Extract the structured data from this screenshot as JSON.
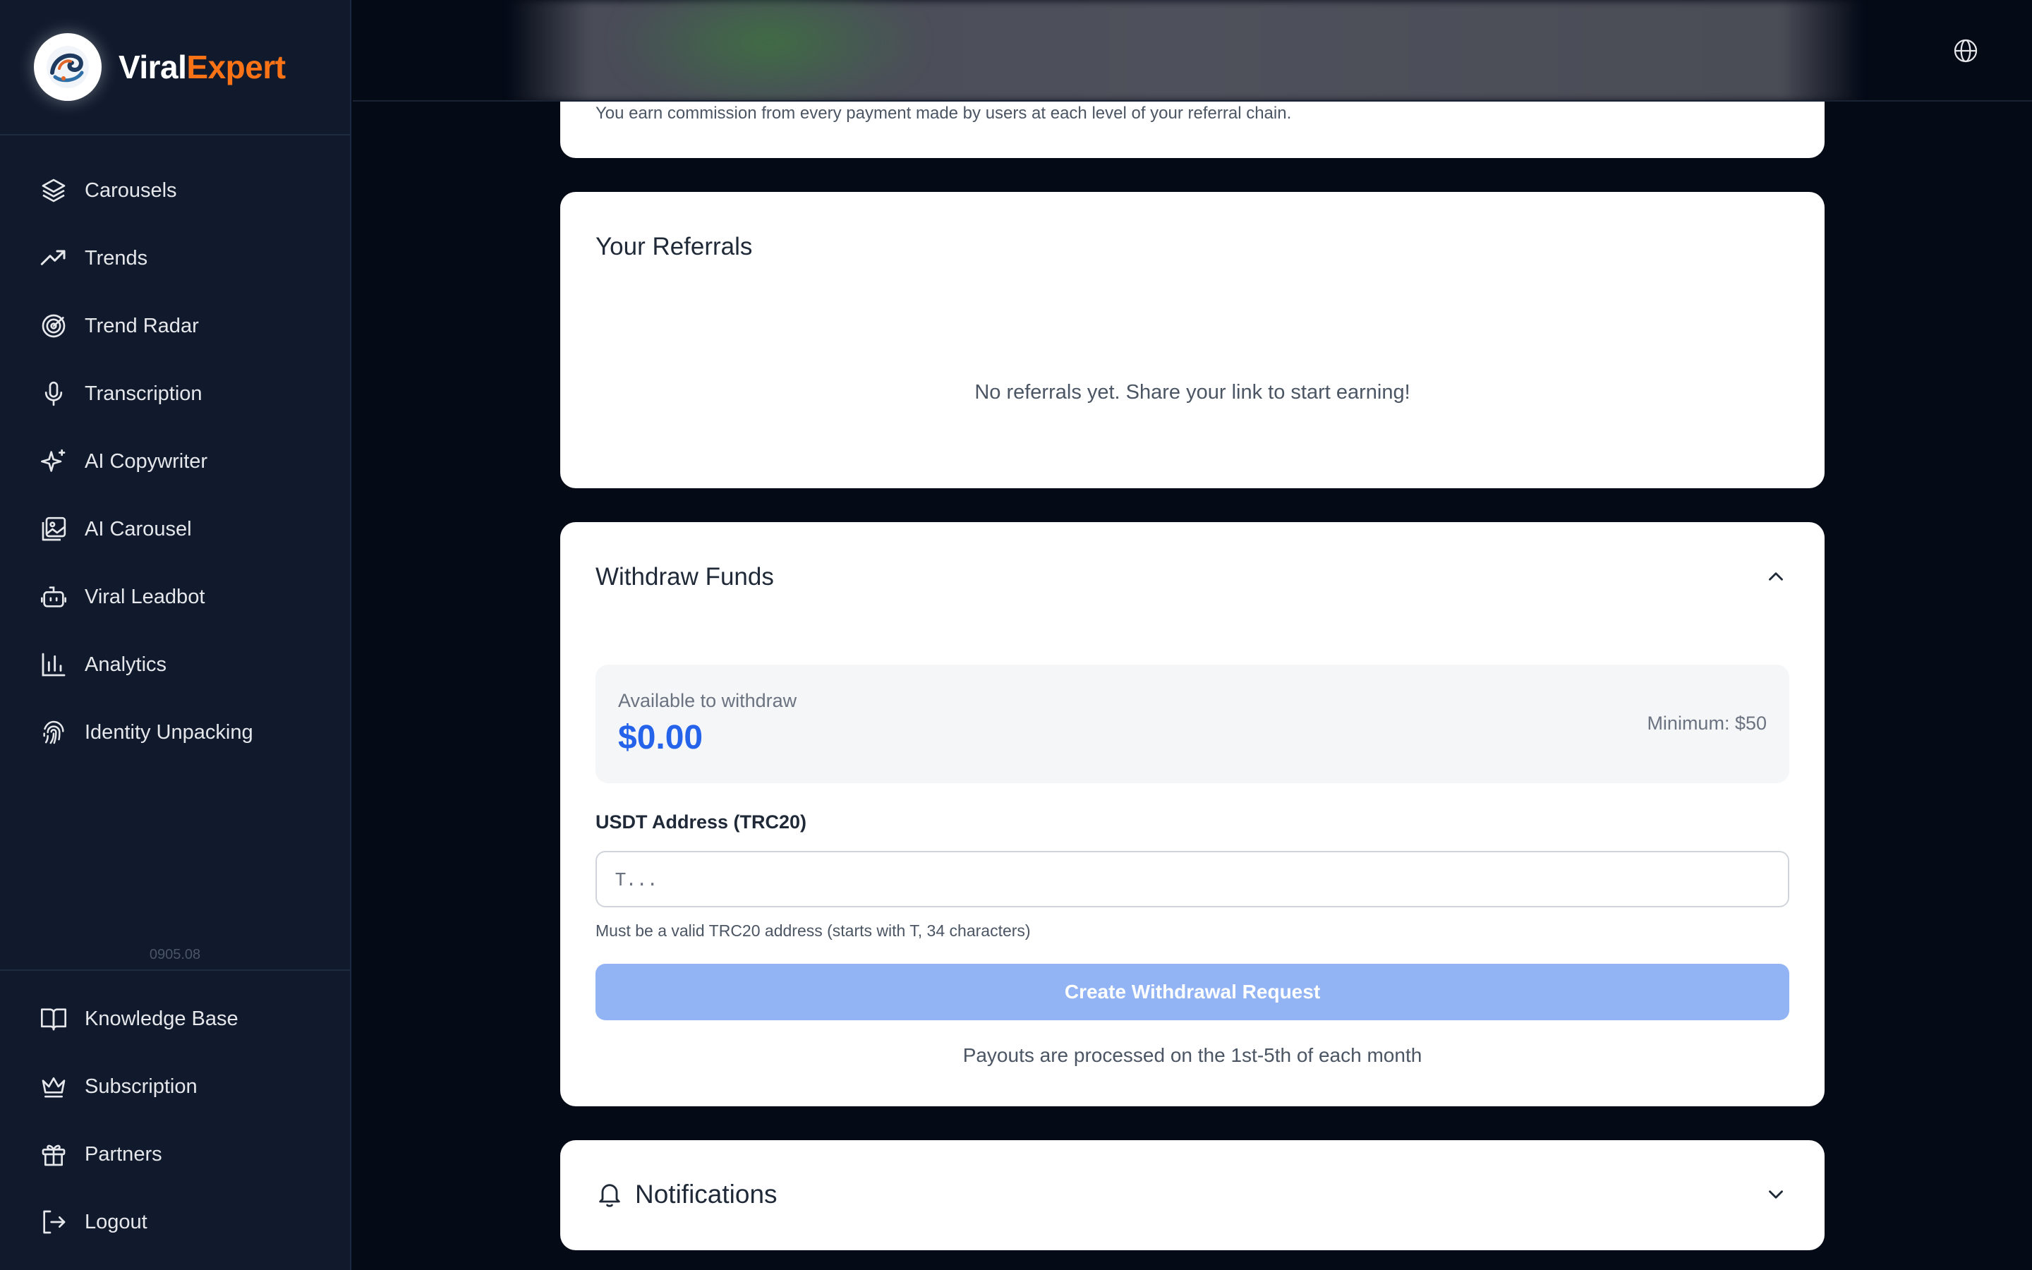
{
  "brand": {
    "name_part1": "Viral",
    "name_part2": "Expert"
  },
  "sidebar": {
    "items": [
      {
        "label": "Carousels",
        "icon": "layers-icon"
      },
      {
        "label": "Trends",
        "icon": "trending-up-icon"
      },
      {
        "label": "Trend Radar",
        "icon": "radar-icon"
      },
      {
        "label": "Transcription",
        "icon": "microphone-icon"
      },
      {
        "label": "AI Copywriter",
        "icon": "sparkles-icon"
      },
      {
        "label": "AI Carousel",
        "icon": "images-icon"
      },
      {
        "label": "Viral Leadbot",
        "icon": "bot-icon"
      },
      {
        "label": "Analytics",
        "icon": "bar-chart-icon"
      },
      {
        "label": "Identity Unpacking",
        "icon": "fingerprint-icon"
      }
    ],
    "version": "0905.08",
    "bottom_items": [
      {
        "label": "Knowledge Base",
        "icon": "book-open-icon"
      },
      {
        "label": "Subscription",
        "icon": "crown-icon"
      },
      {
        "label": "Partners",
        "icon": "gift-icon"
      },
      {
        "label": "Logout",
        "icon": "logout-icon"
      }
    ]
  },
  "topbar": {
    "language_icon": "globe-icon"
  },
  "commission_card": {
    "text": "You earn commission from every payment made by users at each level of your referral chain."
  },
  "referrals": {
    "title": "Your Referrals",
    "empty_message": "No referrals yet. Share your link to start earning!"
  },
  "withdraw": {
    "title": "Withdraw Funds",
    "available_label": "Available to withdraw",
    "available_amount": "$0.00",
    "minimum": "Minimum: $50",
    "address_label": "USDT Address (TRC20)",
    "address_placeholder": "T...",
    "address_value": "",
    "address_hint": "Must be a valid TRC20 address (starts with T, 34 characters)",
    "button_label": "Create Withdrawal Request",
    "payout_note": "Payouts are processed on the 1st-5th of each month"
  },
  "notifications": {
    "title": "Notifications"
  },
  "colors": {
    "background": "#050a17",
    "sidebar": "#101a2c",
    "brand_accent": "#f97316",
    "amount_blue": "#2563eb",
    "button_disabled": "#93b4f4"
  }
}
